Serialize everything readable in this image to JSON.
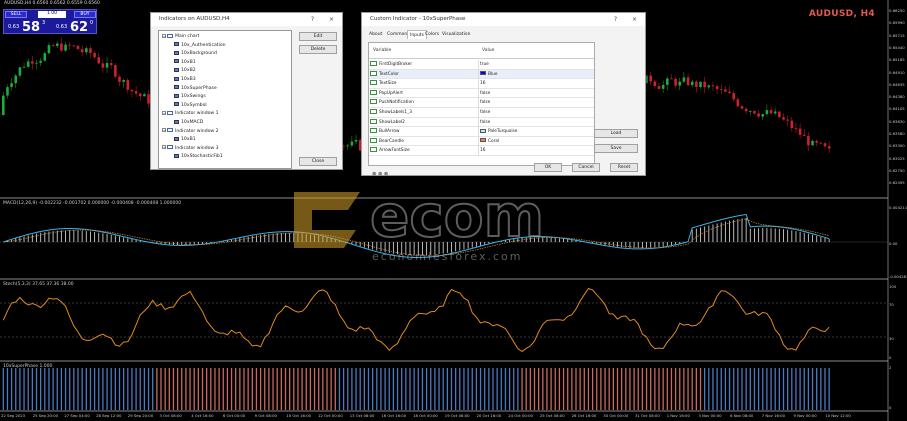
{
  "chart": {
    "symbol_header": "AUDUSD,H4 0.6560 0.6562 0.6559 0.6560",
    "symbol_label": "AUDUSD, H4",
    "trade_panel": {
      "sell_label": "SELL",
      "buy_label": "BUY",
      "lot": "1.00",
      "sell_small": "0.63",
      "sell_big": "58",
      "sell_sup": "3",
      "buy_small": "0.63",
      "buy_big": "62",
      "buy_sup": "0"
    },
    "price_axis": [
      "0.66250",
      "0.65990",
      "0.65715",
      "0.65440",
      "0.65185",
      "0.64910",
      "0.64635",
      "0.64380",
      "0.64105",
      "0.63830",
      "0.63580",
      "0.63300",
      "0.63025",
      "0.62750",
      "0.62495"
    ],
    "macd_label": "MACD(12,26,9) -0.002232 -0.001702 0.000000 -0.000408 -0.000408 1.000000",
    "macd_axis": [
      "0.004211",
      "0.00",
      "-0.004281"
    ],
    "stoch_label": "Stoch(5,3,3) 37.65 37.36 38.00",
    "stoch_axis": [
      "100",
      "70",
      "30",
      "0"
    ],
    "sp_label": "10xSuperPhase 1.000",
    "sp_axis": [
      "2",
      "0"
    ],
    "time_axis": [
      "22 Sep 2023",
      "25 Sep 20:00",
      "27 Sep 04:00",
      "28 Sep 12:00",
      "29 Sep 20:00",
      "3 Oct 08:00",
      "4 Oct 16:00",
      "6 Oct 00:00",
      "9 Oct 08:00",
      "10 Oct 16:00",
      "12 Oct 00:00",
      "13 Oct 08:00",
      "16 Oct 16:00",
      "18 Oct 00:00",
      "19 Oct 08:00",
      "20 Oct 16:00",
      "24 Oct 00:00",
      "25 Oct 08:00",
      "26 Oct 16:00",
      "30 Oct 00:00",
      "31 Oct 08:00",
      "1 Nov 16:00",
      "3 Nov 00:00",
      "6 Nov 08:00",
      "7 Nov 16:00",
      "9 Nov 00:00",
      "10 Nov 12:00"
    ]
  },
  "indicators_dialog": {
    "title": "Indicators on AUDUSD,H4",
    "help": "?",
    "close_x": "×",
    "tree": [
      {
        "label": "Main chart",
        "level": 0,
        "type": "folder"
      },
      {
        "label": "10x_Authentication",
        "level": 1,
        "type": "ind"
      },
      {
        "label": "10xBackground",
        "level": 1,
        "type": "ind"
      },
      {
        "label": "10xB1",
        "level": 1,
        "type": "ind"
      },
      {
        "label": "10xB2",
        "level": 1,
        "type": "ind"
      },
      {
        "label": "10xB3",
        "level": 1,
        "type": "ind"
      },
      {
        "label": "10xSuperPhase",
        "level": 1,
        "type": "ind"
      },
      {
        "label": "10xSwings",
        "level": 1,
        "type": "ind"
      },
      {
        "label": "10xSymbol",
        "level": 1,
        "type": "ind"
      },
      {
        "label": "Indicator window 1",
        "level": 0,
        "type": "folder"
      },
      {
        "label": "10xMACD",
        "level": 1,
        "type": "ind"
      },
      {
        "label": "Indicator window 2",
        "level": 0,
        "type": "folder"
      },
      {
        "label": "10xB1",
        "level": 1,
        "type": "ind"
      },
      {
        "label": "Indicator window 3",
        "level": 0,
        "type": "folder"
      },
      {
        "label": "10xStochasticFib1",
        "level": 1,
        "type": "ind"
      }
    ],
    "edit_label": "Edit",
    "delete_label": "Delete",
    "close_label": "Close"
  },
  "custom_dialog": {
    "title": "Custom Indicator - 10xSuperPhase",
    "help": "?",
    "close_x": "×",
    "tabs": [
      "About",
      "Common",
      "Inputs",
      "Colors",
      "Visualization"
    ],
    "active_tab": 2,
    "col_variable": "Variable",
    "col_value": "Value",
    "rows": [
      {
        "name": "FirstDigitBroker",
        "value": "true",
        "swatch": ""
      },
      {
        "name": "TextColor",
        "value": "Blue",
        "swatch": "#0000ff"
      },
      {
        "name": "TextSize",
        "value": "16",
        "swatch": ""
      },
      {
        "name": "PopUpAlert",
        "value": "false",
        "swatch": ""
      },
      {
        "name": "PushNotification",
        "value": "false",
        "swatch": ""
      },
      {
        "name": "ShowLabels1_3",
        "value": "false",
        "swatch": ""
      },
      {
        "name": "ShowLabel2",
        "value": "false",
        "swatch": ""
      },
      {
        "name": "BullArrow",
        "value": "PaleTurquoise",
        "swatch": "#afeeee"
      },
      {
        "name": "BearCandle",
        "value": "Coral",
        "swatch": "#ff7f50"
      },
      {
        "name": "ArrowFontSize",
        "value": "16",
        "swatch": ""
      }
    ],
    "load_label": "Load",
    "save_label": "Save",
    "ok_label": "OK",
    "cancel_label": "Cancel",
    "reset_label": "Reset"
  },
  "watermark": {
    "text": "ecom",
    "sub": "economiesforex.com"
  },
  "colors": {
    "bull": "#1faa3c",
    "bear": "#d0202c",
    "macd_main": "#3bb0e6",
    "macd_signal": "#d48a3a",
    "stoch": "#e08a20",
    "sp_blue": "#4a7ac0",
    "sp_red": "#c86a60"
  }
}
